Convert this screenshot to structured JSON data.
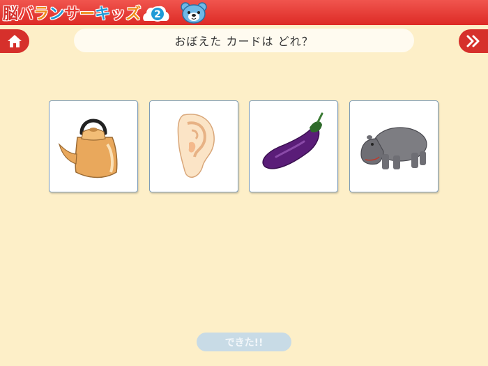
{
  "header": {
    "logo_chars": [
      "脳",
      "バ",
      "ラ",
      "ン",
      "サ",
      "ー",
      "キ",
      "ッ",
      "ズ"
    ],
    "logo_colors": [
      "#d6302b",
      "#e9352f",
      "#f08d1d",
      "#1f9ad6",
      "#e9352f",
      "#f08d1d",
      "#1f9ad6",
      "#e9352f",
      "#f08d1d"
    ],
    "level": "2"
  },
  "nav": {
    "home_icon": "home-icon",
    "next_icon": "double-chevron-right-icon"
  },
  "question": {
    "text": "おぼえた カードは どれ？"
  },
  "cards": [
    {
      "icon": "kettle-icon"
    },
    {
      "icon": "ear-icon"
    },
    {
      "icon": "eggplant-icon"
    },
    {
      "icon": "hippo-icon"
    }
  ],
  "done_button": {
    "label": "できた!!",
    "enabled": false
  },
  "colors": {
    "header_red": "#dd2a25",
    "background": "#fdefc8",
    "card_border": "#7d9cb8",
    "done_disabled": "#c8dbe6"
  }
}
